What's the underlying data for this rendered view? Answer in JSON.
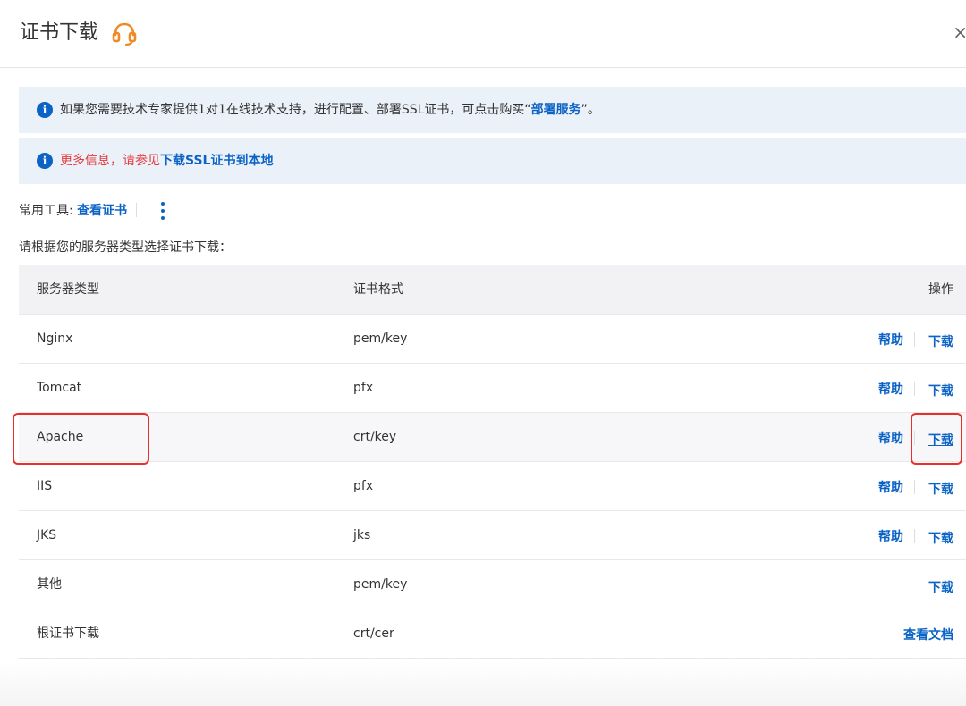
{
  "dialog": {
    "title": "证书下载",
    "close_symbol": "×",
    "support_icon": "headset-icon",
    "accent_color": "#0b63c6",
    "highlight_color": "#e8302a"
  },
  "notices": {
    "notice1": {
      "prefix": "如果您需要技术专家提供1对1在线技术支持，进行配置、部署SSL证书，可点击购买“",
      "link": "部署服务",
      "suffix": "”。"
    },
    "notice2": {
      "prefix": "更多信息，请参见",
      "link": "下载SSL证书到本地"
    }
  },
  "tools": {
    "label": "常用工具:",
    "link": "查看证书"
  },
  "subtitle": "请根据您的服务器类型选择证书下载：",
  "table": {
    "headers": {
      "server_type": "服务器类型",
      "format": "证书格式",
      "actions": "操作"
    },
    "rows": [
      {
        "server": "Nginx",
        "format": "pem/key",
        "help": "帮助",
        "download": "下载"
      },
      {
        "server": "Tomcat",
        "format": "pfx",
        "help": "帮助",
        "download": "下载"
      },
      {
        "server": "Apache",
        "format": "crt/key",
        "help": "帮助",
        "download": "下载"
      },
      {
        "server": "IIS",
        "format": "pfx",
        "help": "帮助",
        "download": "下载"
      },
      {
        "server": "JKS",
        "format": "jks",
        "help": "帮助",
        "download": "下载"
      },
      {
        "server": "其他",
        "format": "pem/key",
        "download": "下载"
      },
      {
        "server": "根证书下载",
        "format": "crt/cer",
        "view_doc": "查看文档"
      }
    ]
  }
}
